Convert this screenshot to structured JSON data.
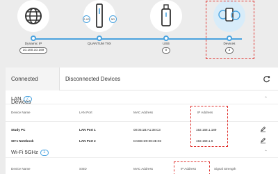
{
  "topology": {
    "internet": {
      "label": "Dynamic IP",
      "value": "10.100.10.169",
      "icon": "globe-icon"
    },
    "router": {
      "label": "QUANTUM T9X",
      "band_left": "2.4G",
      "band_right": "5G",
      "icon": "router-icon"
    },
    "usb": {
      "label": "USB",
      "value": "0",
      "icon": "usb-drive-icon"
    },
    "devices": {
      "label": "Devices",
      "value": "3",
      "icon": "devices-icon"
    },
    "colors": {
      "accent": "#4aa3df",
      "highlight": "#e0312d"
    }
  },
  "tabs": [
    {
      "label": "Connected Devices"
    },
    {
      "label": "Disconnected Devices"
    }
  ],
  "lan": {
    "title": "LAN",
    "count": "2",
    "headers": {
      "name": "Device Name",
      "port": "LAN Port",
      "mac": "MAC Address",
      "ip": "IP Address"
    },
    "rows": [
      {
        "name": "Study PC",
        "port": "LAN Port 1",
        "mac": "00:05:1B:A1:38:C3",
        "ip": "192.168.1.189"
      },
      {
        "name": "SH's Notebook",
        "port": "LAN Port 2",
        "mac": "D4:BE:D9:08:3E:93",
        "ip": "192.168.1.6"
      }
    ]
  },
  "wifi": {
    "title": "Wi-Fi 5GHz",
    "count": "1",
    "headers": {
      "name": "Device Name",
      "ssid": "SSID",
      "mac": "MAC Address",
      "ip": "IP Address",
      "signal": "Signal Strength"
    }
  }
}
